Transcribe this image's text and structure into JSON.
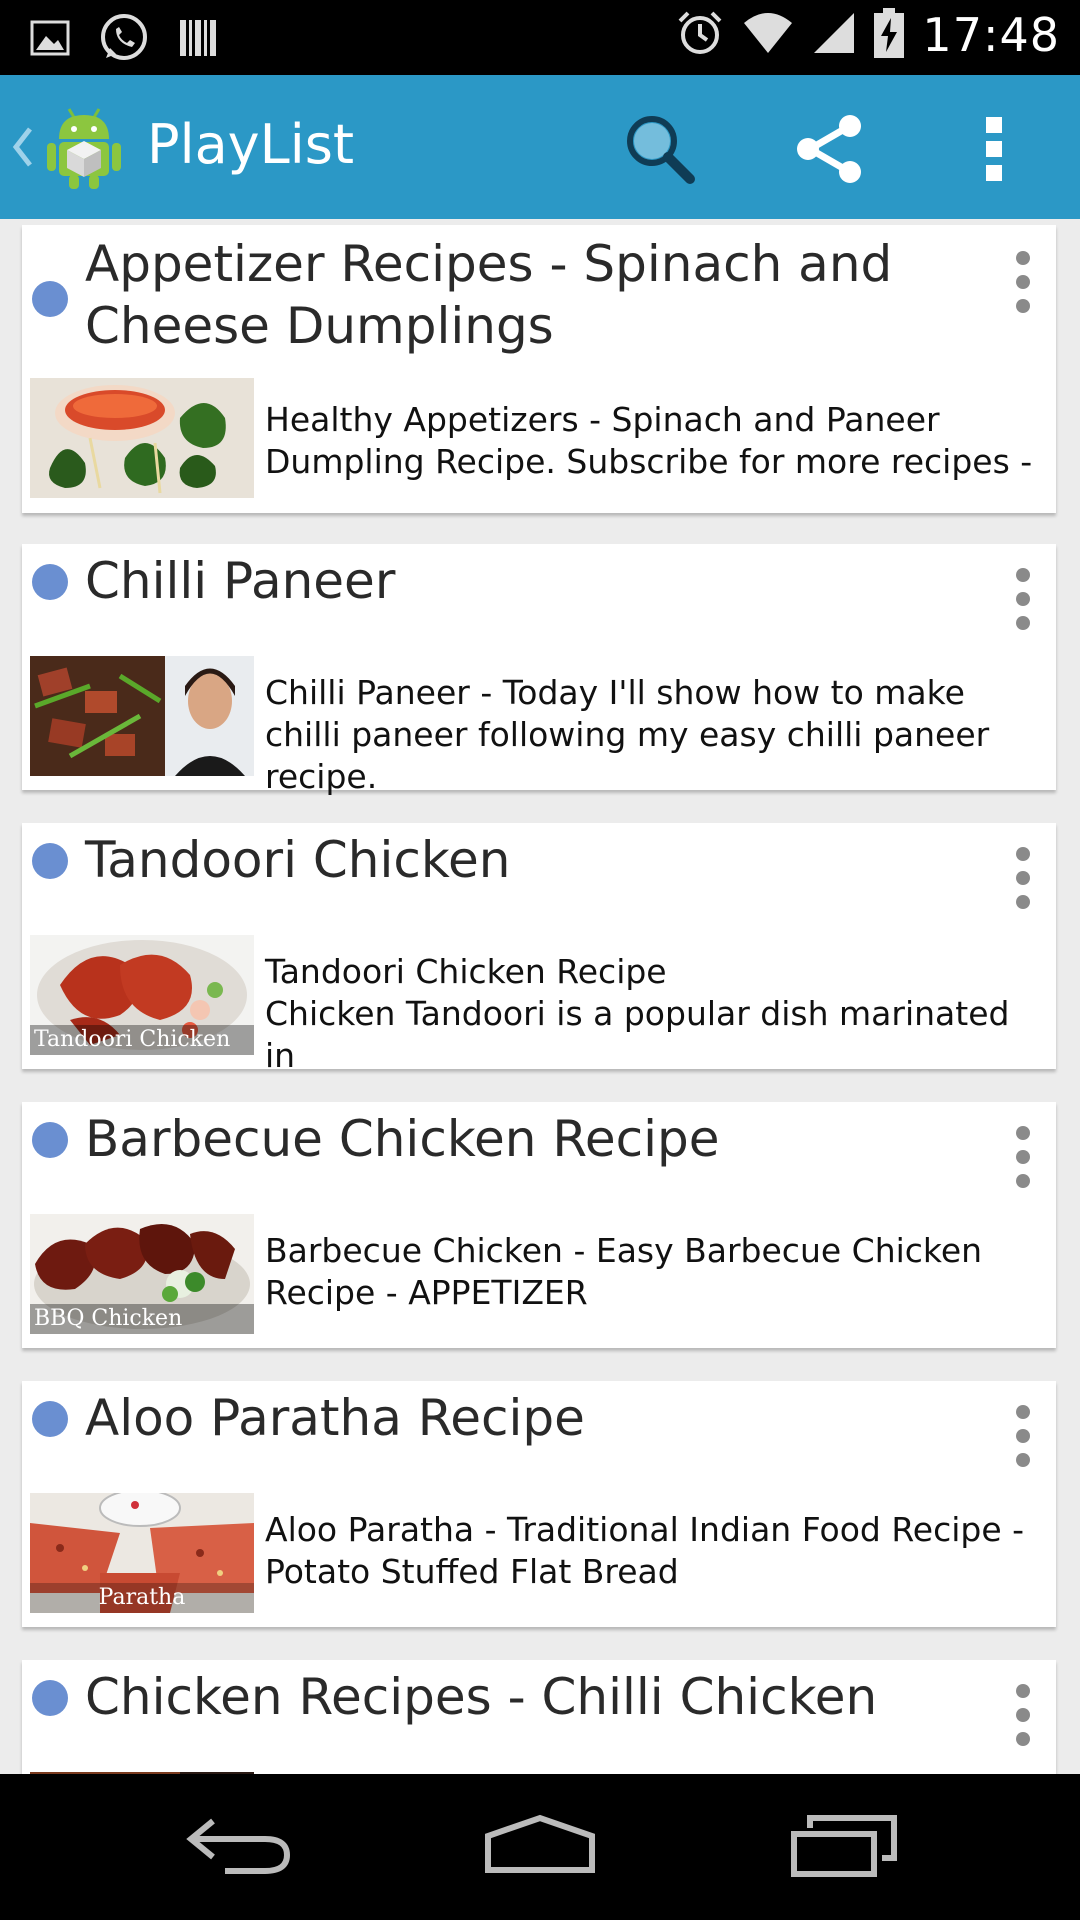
{
  "status_bar": {
    "time": "17:48",
    "left_icons": [
      "gallery-icon",
      "whatsapp-icon",
      "barcode-icon"
    ],
    "right_icons": [
      "alarm-icon",
      "wifi-icon",
      "signal-icon",
      "battery-charging-icon"
    ]
  },
  "action_bar": {
    "title": "PlayList",
    "background_color": "#2b98c6",
    "actions": [
      "search-icon",
      "share-icon",
      "overflow-menu-icon"
    ]
  },
  "playlist": {
    "dot_color": "#6a8fd1",
    "items": [
      {
        "title": "Appetizer Recipes  - Spinach and Cheese Dumplings",
        "description": "Healthy Appetizers - Spinach and Paneer Dumpling Recipe. Subscribe for more recipes -",
        "thumbnail_label": ""
      },
      {
        "title": "Chilli Paneer",
        "description": "Chilli Paneer - Today I'll show how to make chilli paneer following my easy chilli paneer recipe.",
        "thumbnail_label": ""
      },
      {
        "title": "Tandoori Chicken",
        "description": "Tandoori Chicken Recipe\nChicken Tandoori is a popular dish marinated in",
        "thumbnail_label": "Tandoori Chicken"
      },
      {
        "title": "Barbecue Chicken Recipe",
        "description": "Barbecue Chicken - Easy Barbecue Chicken Recipe - APPETIZER",
        "thumbnail_label": "BBQ Chicken"
      },
      {
        "title": "Aloo Paratha Recipe",
        "description": "Aloo Paratha - Traditional Indian Food Recipe - Potato Stuffed Flat Bread",
        "thumbnail_label": "Paratha"
      },
      {
        "title": "Chicken Recipes - Chilli Chicken",
        "description": "",
        "thumbnail_label": ""
      }
    ]
  },
  "nav_bar": {
    "buttons": [
      "back-icon",
      "home-icon",
      "recent-apps-icon"
    ]
  }
}
